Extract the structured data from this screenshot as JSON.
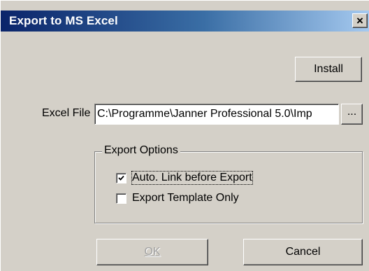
{
  "dialog": {
    "title": "Export to MS Excel",
    "close_glyph": "×"
  },
  "buttons": {
    "install": "Install",
    "browse": "...",
    "ok": "OK",
    "cancel": "Cancel"
  },
  "excel_file": {
    "label": "Excel File",
    "value": "C:\\Programme\\Janner Professional 5.0\\Imp"
  },
  "export_options": {
    "legend": "Export Options",
    "auto_link": {
      "label": "Auto. Link before Export",
      "checked": true
    },
    "template_only": {
      "label": "Export Template Only",
      "checked": false
    }
  },
  "icons": {
    "close": "close-icon",
    "checkmark": "checkmark-icon"
  },
  "colors": {
    "titlebar_start": "#0a246a",
    "titlebar_end": "#a6caf0",
    "face": "#d4d0c8"
  }
}
